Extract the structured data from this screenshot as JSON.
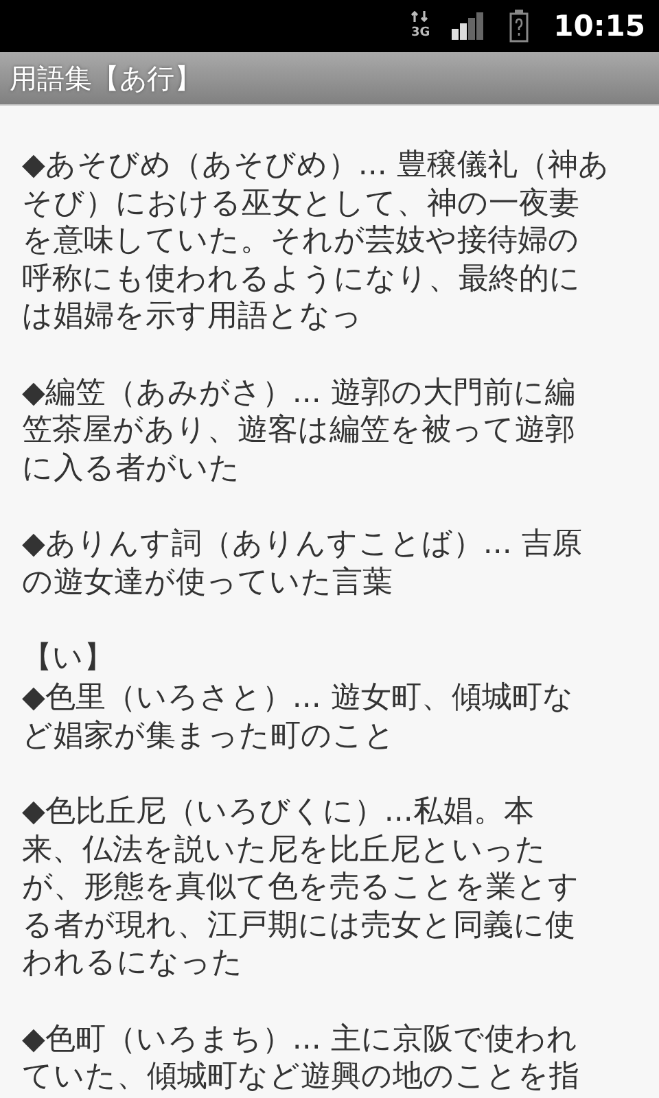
{
  "status_bar": {
    "network": "3G",
    "time": "10:15"
  },
  "title": "用語集【あ行】",
  "items": [
    {
      "kind": "entry",
      "lines": [
        "◆あそびめ（あそびめ）... 豊穣儀礼（神あ",
        "そび）における巫女として、神の一夜妻",
        "を意味していた。それが芸妓や接待婦の",
        "呼称にも使われるようになり、最終的に",
        "は娼婦を示す用語となっ"
      ]
    },
    {
      "kind": "entry",
      "lines": [
        "◆編笠（あみがさ）...  遊郭の大門前に編",
        "笠茶屋があり、遊客は編笠を被って遊郭",
        "に入る者がいた"
      ]
    },
    {
      "kind": "entry",
      "lines": [
        "◆ありんす詞（ありんすことば）...  吉原",
        "の遊女達が使っていた言葉"
      ]
    },
    {
      "kind": "heading",
      "lines": [
        "【い】"
      ]
    },
    {
      "kind": "entry",
      "lines": [
        "◆色里（いろさと）...  遊女町、傾城町な",
        "ど娼家が集まった町のこと"
      ]
    },
    {
      "kind": "entry",
      "lines": [
        "◆色比丘尼（いろびくに）...私娼。本",
        "来、仏法を説いた尼を比丘尼といった",
        "が、形態を真似て色を売ることを業とす",
        "る者が現れ、江戸期には売女と同義に使",
        "われるになった"
      ]
    },
    {
      "kind": "entry",
      "lines": [
        "◆色町（いろまち）...  主に京阪で使われ",
        "ていた、傾城町など遊興の地のことを指"
      ]
    }
  ]
}
